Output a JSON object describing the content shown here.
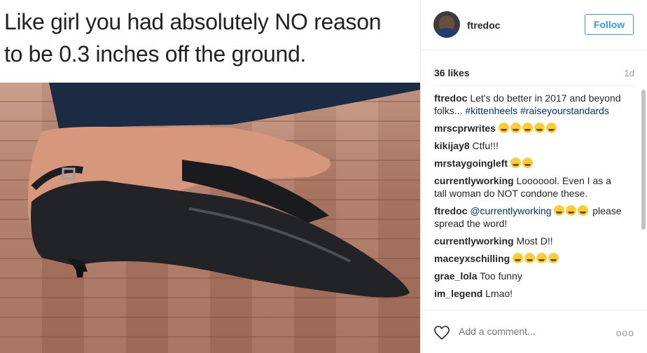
{
  "meme": {
    "line1": "Like girl you had absolutely NO reason",
    "line2": "to be 0.3 inches off the ground."
  },
  "header": {
    "username": "ftredoc",
    "follow_label": "Follow"
  },
  "stats": {
    "likes": "36 likes",
    "age": "1d"
  },
  "comments": [
    {
      "user": "ftredoc",
      "text": "Let's do better in 2017 and beyond folks...",
      "tags": [
        "#kittenheels",
        "#raiseyourstandards"
      ]
    },
    {
      "user": "mrscprwrites",
      "text": "",
      "emoji_count": 5
    },
    {
      "user": "kikijay8",
      "text": "Ctfu!!!"
    },
    {
      "user": "mrstaygoingleft",
      "text": "",
      "emoji_count": 2
    },
    {
      "user": "currentlyworking",
      "text": "Looooool. Even I as a tall woman do NOT condone these."
    },
    {
      "user": "ftredoc",
      "mention": "@currentlyworking",
      "text": "please spread the word!",
      "emoji_count": 3
    },
    {
      "user": "currentlyworking",
      "text": "Most D!!"
    },
    {
      "user": "maceyxschilling",
      "text": "",
      "emoji_count": 4
    },
    {
      "user": "grae_lola",
      "text": "Too funny"
    },
    {
      "user": "im_legend",
      "text": "Lmao!"
    }
  ],
  "footer": {
    "comment_placeholder": "Add a comment...",
    "more_label": "ooo"
  },
  "icons": {
    "heart": "heart-outline-icon",
    "more": "more-options-icon"
  },
  "colors": {
    "follow_blue": "#3897f0",
    "hashtag": "#003569",
    "muted": "#999999"
  }
}
